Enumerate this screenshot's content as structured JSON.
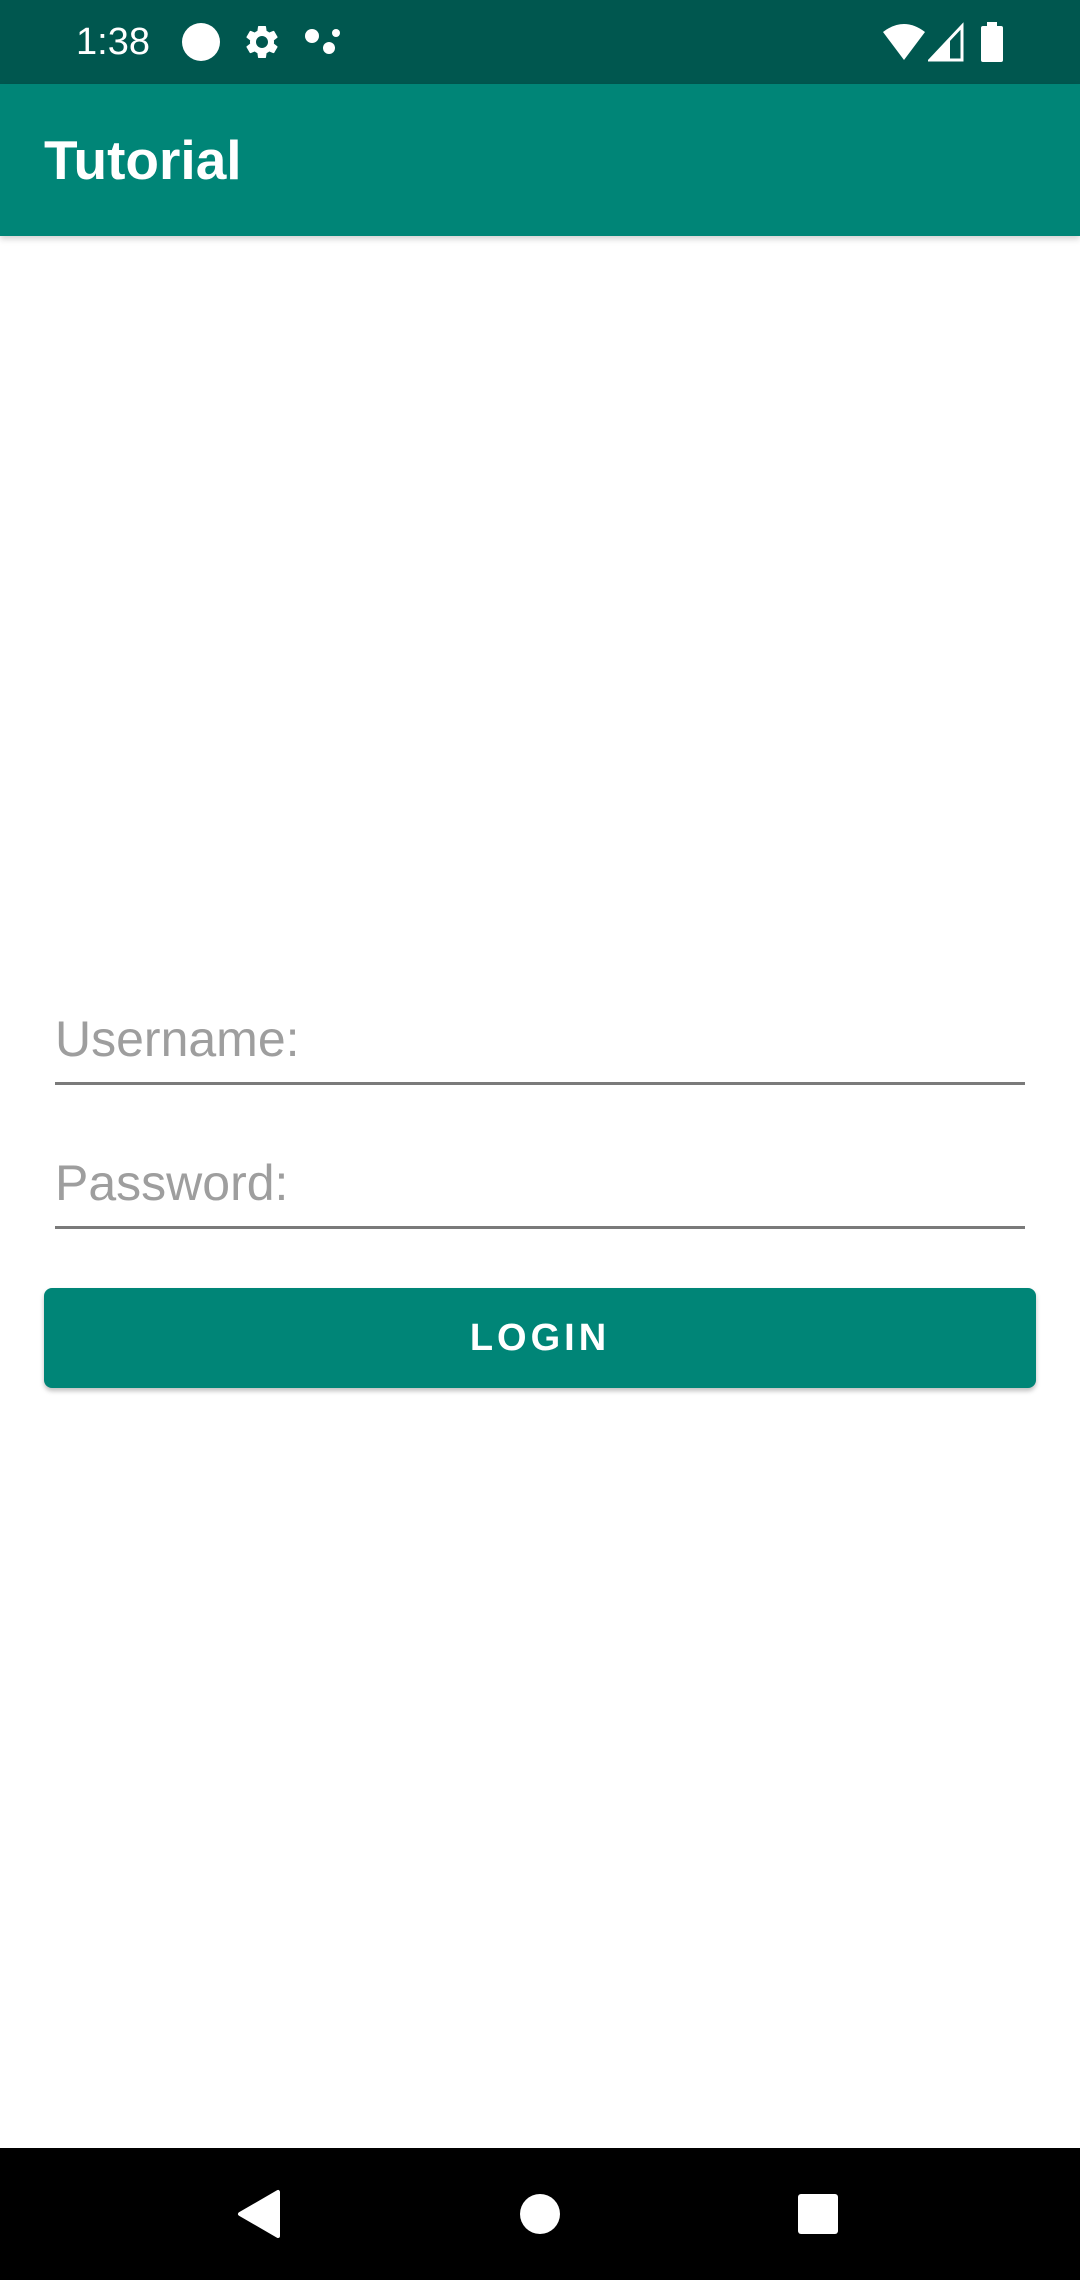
{
  "status_bar": {
    "time": "1:38",
    "left_icons": [
      "circle-notification-icon",
      "settings-gear-icon",
      "dots-notification-icon"
    ],
    "right_icons": [
      "wifi-icon",
      "cellular-signal-icon",
      "battery-icon"
    ]
  },
  "app_bar": {
    "title": "Tutorial"
  },
  "form": {
    "username": {
      "placeholder": "Username:",
      "value": ""
    },
    "password": {
      "placeholder": "Password:",
      "value": ""
    },
    "login_label": "LOGIN"
  },
  "nav_bar": {
    "icons": [
      "back-icon",
      "home-icon",
      "recents-icon"
    ]
  },
  "colors": {
    "status_bar": "#00574f",
    "primary": "#008577",
    "placeholder_text": "#9e9e9e",
    "nav_bar": "#000000"
  }
}
